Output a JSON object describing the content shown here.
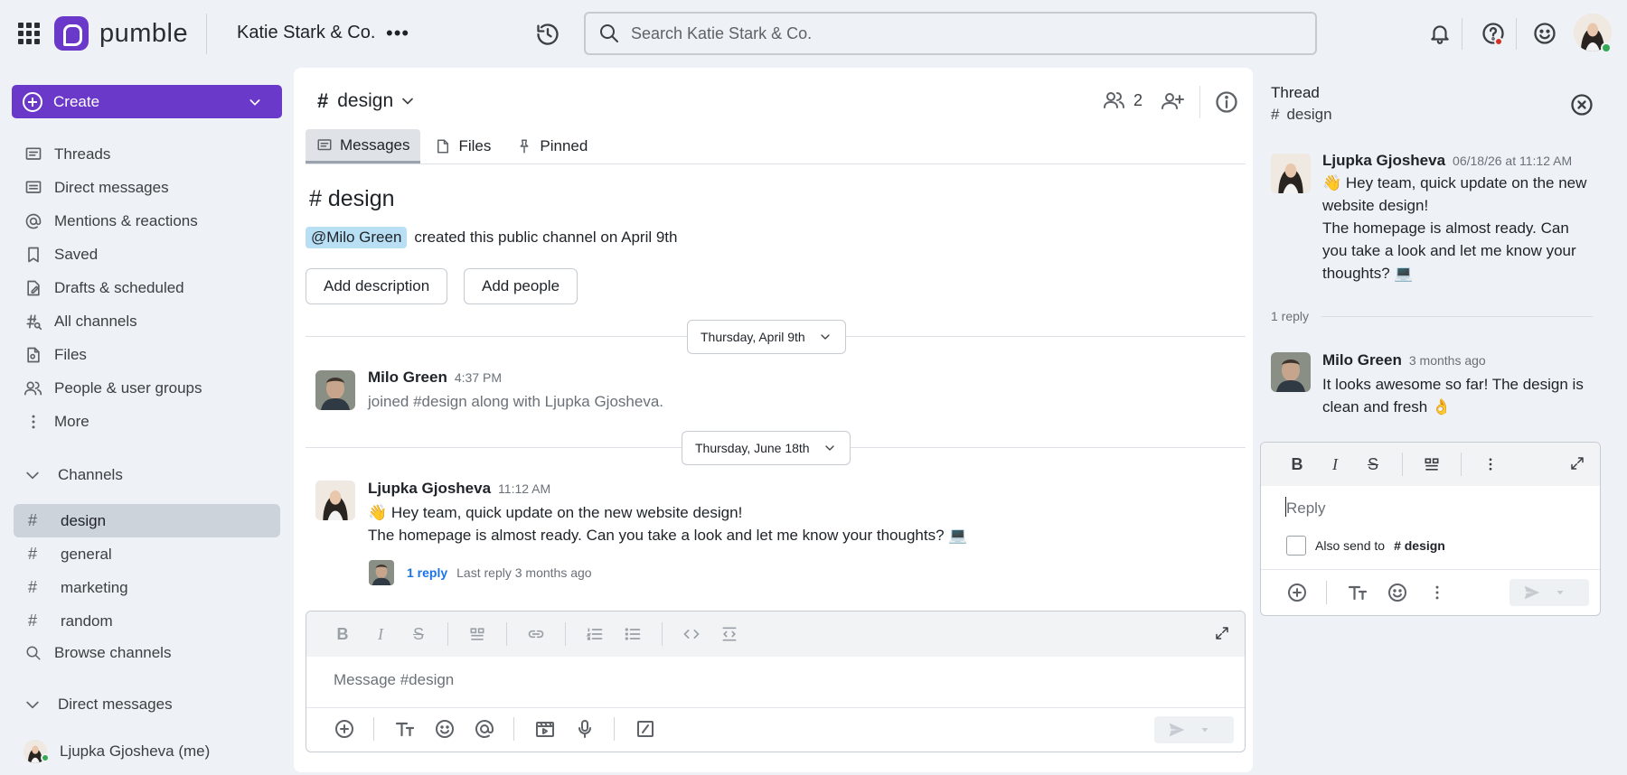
{
  "app": {
    "name": "pumble",
    "workspace": "Katie Stark & Co."
  },
  "search": {
    "placeholder": "Search Katie Stark & Co."
  },
  "sidebar": {
    "create_label": "Create",
    "nav": [
      {
        "label": "Threads",
        "icon": "threads-icon"
      },
      {
        "label": "Direct messages",
        "icon": "direct-messages-icon"
      },
      {
        "label": "Mentions & reactions",
        "icon": "at-icon"
      },
      {
        "label": "Saved",
        "icon": "bookmark-icon"
      },
      {
        "label": "Drafts & scheduled",
        "icon": "drafts-icon"
      },
      {
        "label": "All channels",
        "icon": "all-channels-icon"
      },
      {
        "label": "Files",
        "icon": "file-icon"
      },
      {
        "label": "People & user groups",
        "icon": "people-icon"
      },
      {
        "label": "More",
        "icon": "more-vertical-icon"
      }
    ],
    "channels_heading": "Channels",
    "channels": [
      {
        "label": "design",
        "active": true
      },
      {
        "label": "general",
        "active": false
      },
      {
        "label": "marketing",
        "active": false
      },
      {
        "label": "random",
        "active": false
      }
    ],
    "browse_label": "Browse channels",
    "dm_heading": "Direct messages",
    "dm_self": "Ljupka Gjosheva (me)"
  },
  "channel": {
    "name": "design",
    "member_count": "2",
    "tabs": [
      "Messages",
      "Files",
      "Pinned"
    ],
    "big_title": "# design",
    "creator": "@Milo Green",
    "created_text": "created this public channel on April 9th",
    "add_description": "Add description",
    "add_people": "Add people",
    "date1": "Thursday, April 9th",
    "date2": "Thursday, June 18th",
    "msg1": {
      "name": "Milo Green",
      "time": "4:37 PM",
      "text": "joined #design along with Ljupka Gjosheva."
    },
    "msg2": {
      "name": "Ljupka Gjosheva",
      "time": "11:12 AM",
      "line1": "👋 Hey team, quick update on the new website design!",
      "line2": "The homepage is almost ready. Can you take a look and let me know your thoughts? 💻",
      "reply_count": "1 reply",
      "last_reply": "Last reply 3 months ago"
    },
    "composer_placeholder": "Message #design"
  },
  "thread": {
    "title": "Thread",
    "channel": "design",
    "parent": {
      "name": "Ljupka Gjosheva",
      "time": "06/18/26 at 11:12 AM",
      "text1": "👋 Hey team, quick update on the new website design!",
      "text2": "The homepage is almost ready. Can you take a look and let me know your thoughts? 💻"
    },
    "reply_count": "1 reply",
    "reply": {
      "name": "Milo Green",
      "time": "3 months ago",
      "text": "It looks awesome so far! The design is clean and fresh 👌"
    },
    "reply_placeholder": "Reply",
    "also_send_label": "Also send to",
    "also_send_channel": "# design"
  },
  "colors": {
    "accent": "#6b39c9",
    "link": "#1a73e8",
    "mention_bg": "#b9dff5",
    "online": "#34a853",
    "alert": "#d93025"
  }
}
